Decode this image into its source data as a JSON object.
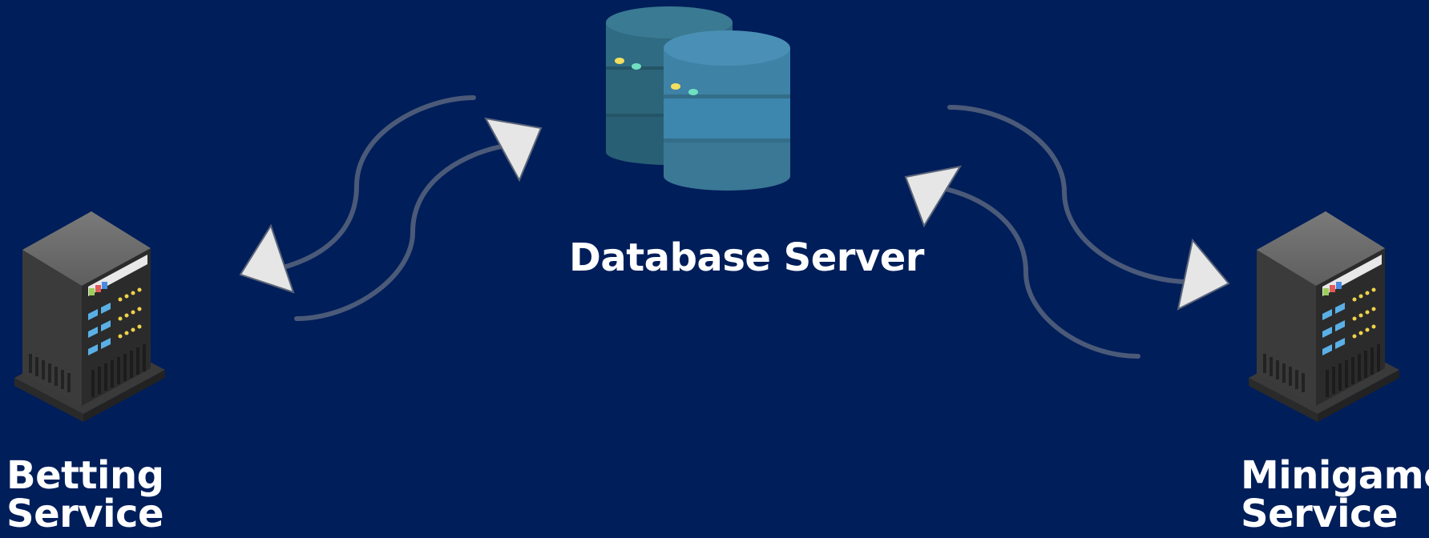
{
  "nodes": {
    "database": {
      "label": "Database Server",
      "icon": "database-icon"
    },
    "betting": {
      "label_line1": "Betting",
      "label_line2": "Service",
      "icon": "server-icon"
    },
    "minigame": {
      "label_line1": "Minigame",
      "label_line2": "Service",
      "icon": "server-icon"
    }
  },
  "connections": [
    {
      "from": "database",
      "to": "betting"
    },
    {
      "from": "betting",
      "to": "database"
    },
    {
      "from": "database",
      "to": "minigame"
    },
    {
      "from": "minigame",
      "to": "database"
    }
  ],
  "colors": {
    "background": "#001e5a",
    "connector": "#4b5a78",
    "arrowhead": "#e6e6e6",
    "db_dark": "#2e6a80",
    "db_light": "#3e86ad",
    "server_body": "#3a3a3a",
    "text": "#ffffff"
  }
}
